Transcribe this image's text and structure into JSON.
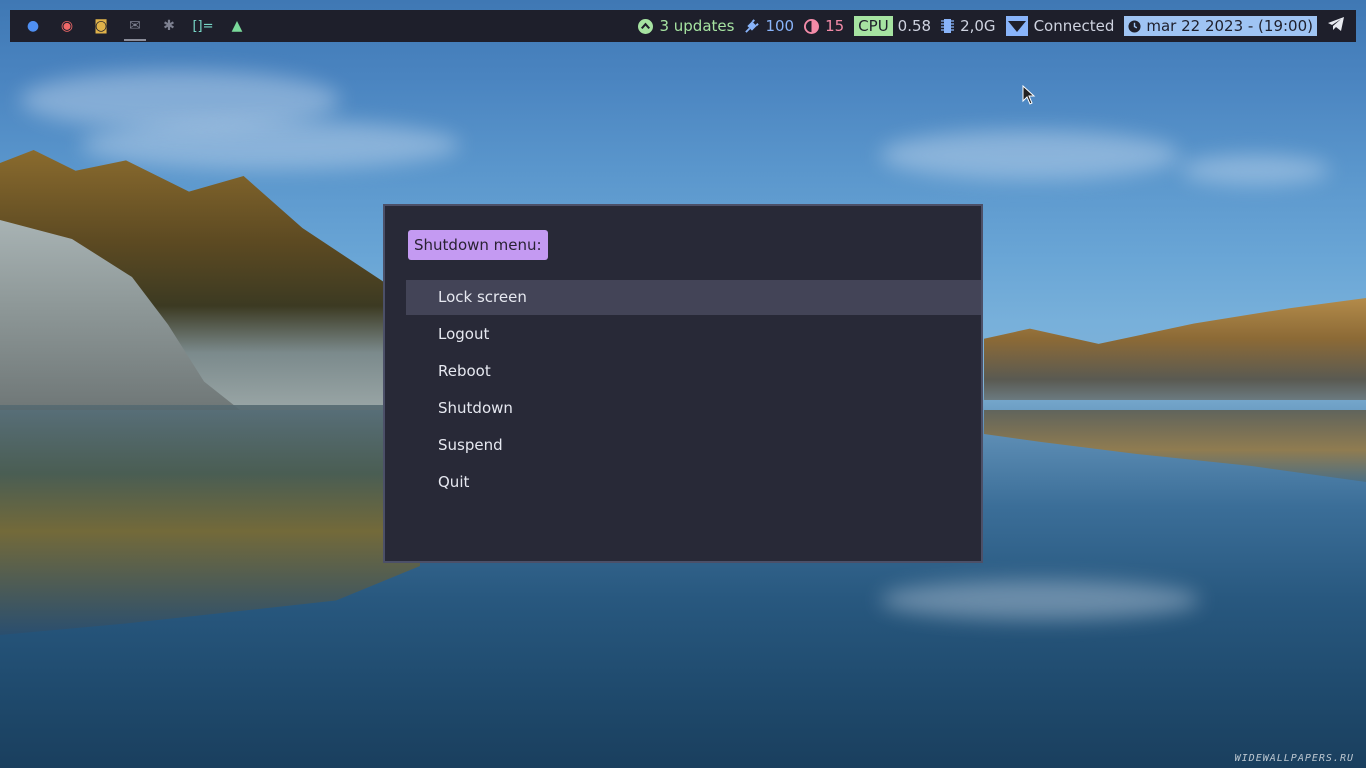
{
  "colors": {
    "bar_bg": "#1e1f2b",
    "menu_bg": "#282937",
    "menu_border": "#4c5068",
    "prompt_bg": "#c49af2",
    "selected_bg": "#434457",
    "updates": "#a6e3a1",
    "power": "#89b4fa",
    "brightness": "#f38ba8",
    "cpu_label_bg": "#a6e3a1",
    "wifi_bg": "#89b4fa",
    "clock_bg": "#9fc4f3"
  },
  "launchers": [
    {
      "icon": "firefox-icon",
      "glyph": "●",
      "color": "#4f8ff2"
    },
    {
      "icon": "chromium-icon",
      "glyph": "◉",
      "color": "#f06868"
    },
    {
      "icon": "pocket-icon",
      "glyph": "◙",
      "color": "#e0b24a"
    },
    {
      "icon": "mail-icon",
      "glyph": "✉",
      "color": "#7d8090"
    },
    {
      "icon": "settings-icon",
      "glyph": "✱",
      "color": "#7d8090"
    },
    {
      "icon": "editor-icon",
      "glyph": "[]=",
      "color": "#78d8c8"
    },
    {
      "icon": "arch-icon",
      "glyph": "▲",
      "color": "#7ad99a"
    }
  ],
  "status": {
    "updates": "3 updates",
    "power": "100",
    "brightness": "15",
    "cpu_label": "CPU",
    "cpu_value": "0.58",
    "memory": "2,0G",
    "network": "Connected",
    "datetime": "mar 22 2023 - (19:00)"
  },
  "menu": {
    "prompt": "Shutdown menu:",
    "selected_index": 0,
    "items": [
      "Lock screen",
      "Logout",
      "Reboot",
      "Shutdown",
      "Suspend",
      "Quit"
    ]
  },
  "watermark": "WIDEWALLPAPERS.RU"
}
